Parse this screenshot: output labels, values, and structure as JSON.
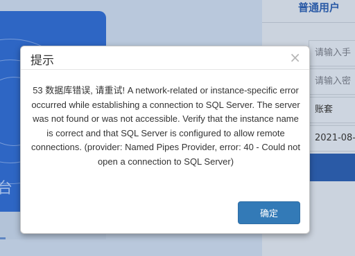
{
  "background": {
    "hero_text": "台",
    "login": {
      "title": "普通用户",
      "fields": [
        {
          "text": "请输入手",
          "kind": "placeholder"
        },
        {
          "text": "请输入密",
          "kind": "placeholder"
        },
        {
          "text": "账套",
          "kind": "value"
        },
        {
          "text": "2021-08-",
          "kind": "value"
        }
      ]
    }
  },
  "dialog": {
    "title": "提示",
    "close_glyph": "×",
    "message": "53 数据库错误, 请重试! A network-related or instance-specific error occurred while establishing a connection to SQL Server. The server was not found or was not accessible. Verify that the instance name is correct and that SQL Server is configured to allow remote connections. (provider: Named Pipes Provider, error: 40 - Could not open a connection to SQL Server)",
    "ok_label": "确定"
  },
  "colors": {
    "primary_button": "#337ab7",
    "hero_blue": "#2e66c4",
    "login_title": "#2a5aa6"
  }
}
